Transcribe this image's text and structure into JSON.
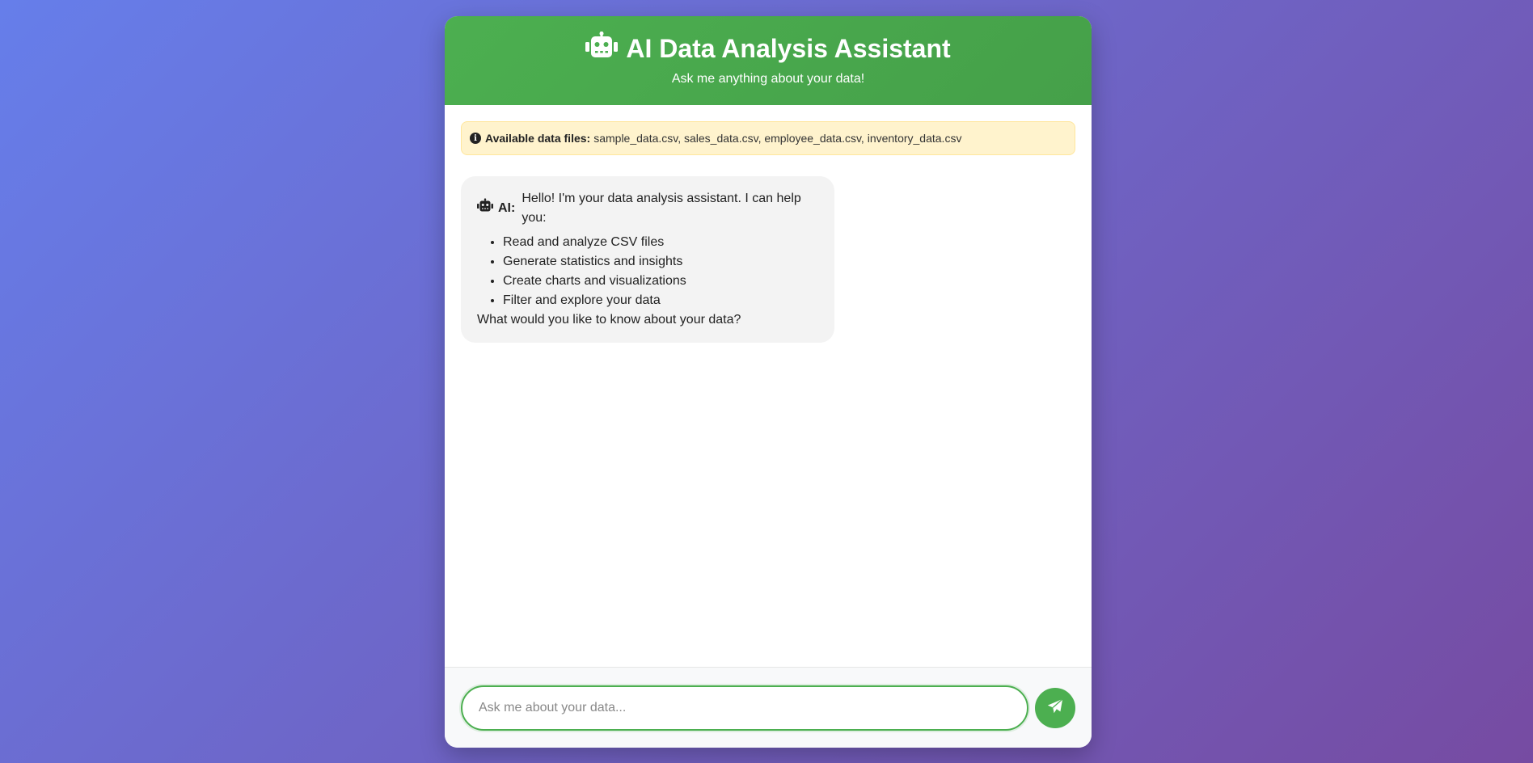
{
  "header": {
    "title": "AI Data Analysis Assistant",
    "subtitle": "Ask me anything about your data!",
    "icon": "robot-icon"
  },
  "info_banner": {
    "icon": "info-circle-icon",
    "label": "Available data files:",
    "files": "sample_data.csv, sales_data.csv, employee_data.csv, inventory_data.csv"
  },
  "messages": [
    {
      "sender": "AI:",
      "icon": "robot-icon",
      "intro": "Hello! I'm your data analysis assistant. I can help you:",
      "items": [
        "Read and analyze CSV files",
        "Generate statistics and insights",
        "Create charts and visualizations",
        "Filter and explore your data"
      ],
      "closing": "What would you like to know about your data?"
    }
  ],
  "input": {
    "placeholder": "Ask me about your data...",
    "value": ""
  },
  "send_button": {
    "icon": "paper-plane-icon"
  },
  "colors": {
    "accent": "#4caf50",
    "background_start": "#667eea",
    "background_end": "#764ba2",
    "banner": "#fff3cd"
  }
}
